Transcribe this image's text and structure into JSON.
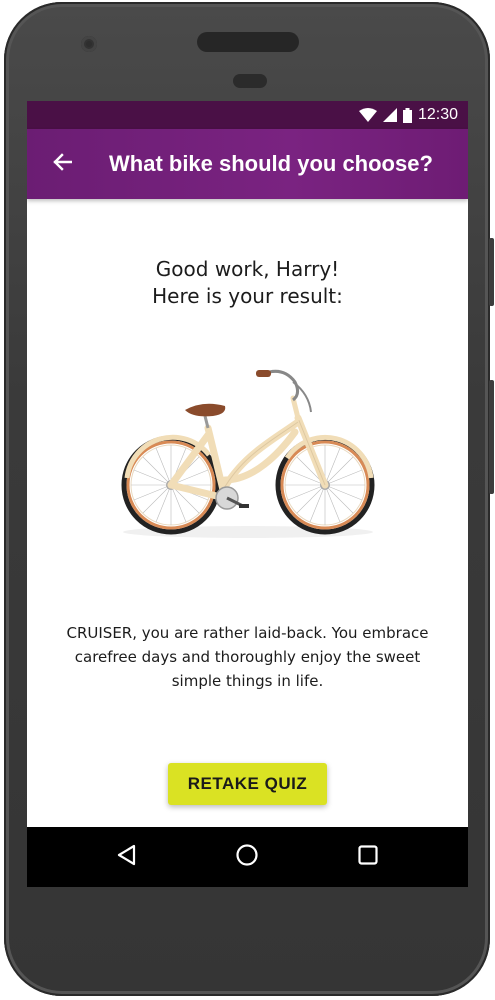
{
  "status_bar": {
    "time": "12:30",
    "icons": [
      "wifi-icon",
      "signal-icon",
      "battery-icon"
    ]
  },
  "app_bar": {
    "title": "What bike should you choose?",
    "back_icon": "arrow-back-icon"
  },
  "result": {
    "greeting": "Good work, Harry!",
    "subheading": "Here is your result:",
    "image": "cruiser-bike-illustration",
    "description": "CRUISER, you are rather laid-back. You embrace carefree days and thoroughly enjoy the sweet simple things in life."
  },
  "actions": {
    "retake_label": "RETAKE QUIZ"
  },
  "nav_bar": {
    "icons": [
      "back-triangle-icon",
      "home-circle-icon",
      "recents-square-icon"
    ]
  },
  "colors": {
    "status_bar": "#4a1046",
    "app_bar": "#7a2381",
    "accent_button": "#dae223",
    "bike_frame": "#f1ddb7",
    "bike_tire_rim": "#c8703a",
    "saddle": "#8a4b2c"
  }
}
